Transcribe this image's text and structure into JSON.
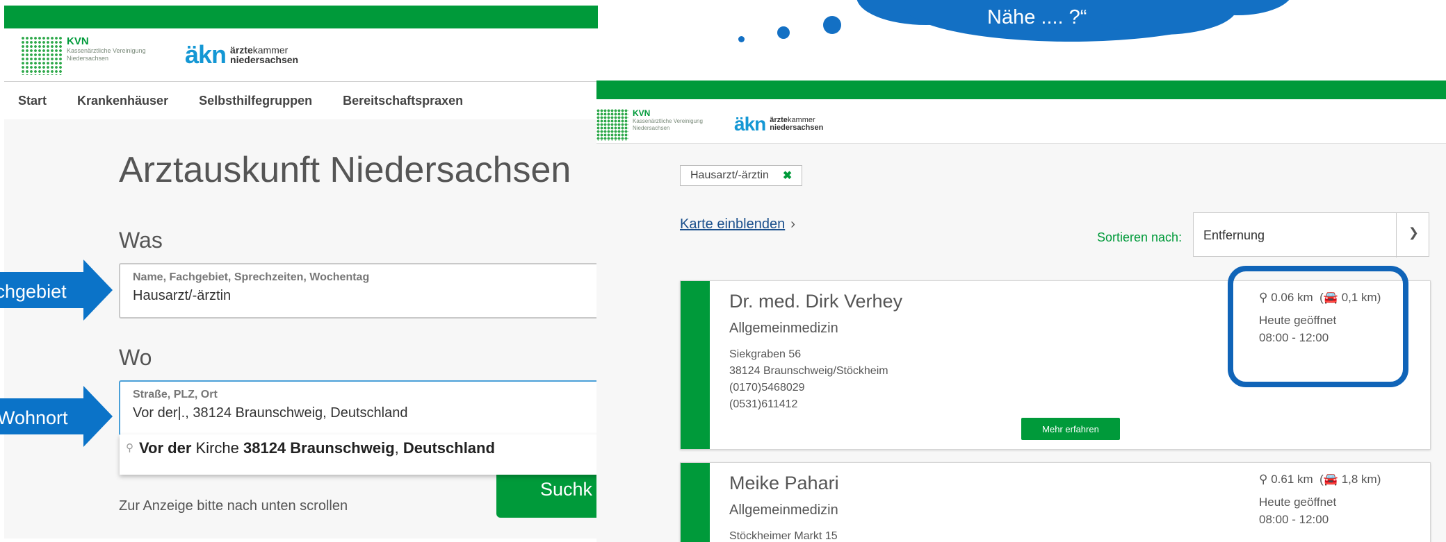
{
  "colors": {
    "brand_green": "#009a3a",
    "callout_blue": "#1370c4",
    "aekn_blue": "#1497d4",
    "link_blue": "#1a4f8c"
  },
  "left": {
    "logo_kvn": {
      "title": "KVN",
      "subtitle": "Kassenärztliche Vereinigung Niedersachsen"
    },
    "logo_aekn": {
      "mark": "äkn",
      "line1_bold": "ärzte",
      "line1_rest": "kammer",
      "line2": "niedersachsen"
    },
    "nav": [
      "Start",
      "Krankenhäuser",
      "Selbsthilfegruppen",
      "Bereitschaftspraxen"
    ],
    "title": "Arztauskunft Niedersachsen",
    "was": {
      "label": "Was",
      "field_label": "Name, Fachgebiet, Sprechzeiten, Wochentag",
      "value": "Hausarzt/-ärztin",
      "arrow_label": "Fachgebiet"
    },
    "wo": {
      "label": "Wo",
      "field_label": "Straße, PLZ, Ort",
      "value": "Vor der|., 38124 Braunschweig, Deutschland",
      "arrow_label": "Wohnort"
    },
    "suggestion": {
      "pin_icon": "map-pin-icon",
      "bold1": "Vor der",
      "plain1": " Kirche ",
      "bold2": "38124 Braunschweig",
      "plain2": ", ",
      "bold3": "Deutschland"
    },
    "hint": "Zur Anzeige bitte nach unten scrollen",
    "search_button": "Suchk"
  },
  "thought": {
    "text": "Nähe .... ?“"
  },
  "right": {
    "filter_chip": {
      "label": "Hausarzt/-ärztin",
      "remove_icon": "✖"
    },
    "map_link": "Karte einblenden",
    "sort": {
      "label": "Sortieren nach:",
      "value": "Entfernung"
    },
    "results": [
      {
        "name": "Dr. med. Dirk Verhey",
        "specialty": "Allgemeinmedizin",
        "street": "Siekgraben 56",
        "city": "38124 Braunschweig/Stöckheim",
        "phone1": "(0170)5468029",
        "phone2": "(0531)611412",
        "distance": "0.06 km",
        "drive": "0,1 km",
        "open_status": "Heute geöffnet",
        "hours": "08:00 - 12:00",
        "more_button": "Mehr erfahren"
      },
      {
        "name": "Meike Pahari",
        "specialty": "Allgemeinmedizin",
        "street": "Stöckheimer Markt 15",
        "distance": "0.61 km",
        "drive": "1,8 km",
        "open_status": "Heute geöffnet",
        "hours": "08:00 - 12:00"
      }
    ]
  }
}
